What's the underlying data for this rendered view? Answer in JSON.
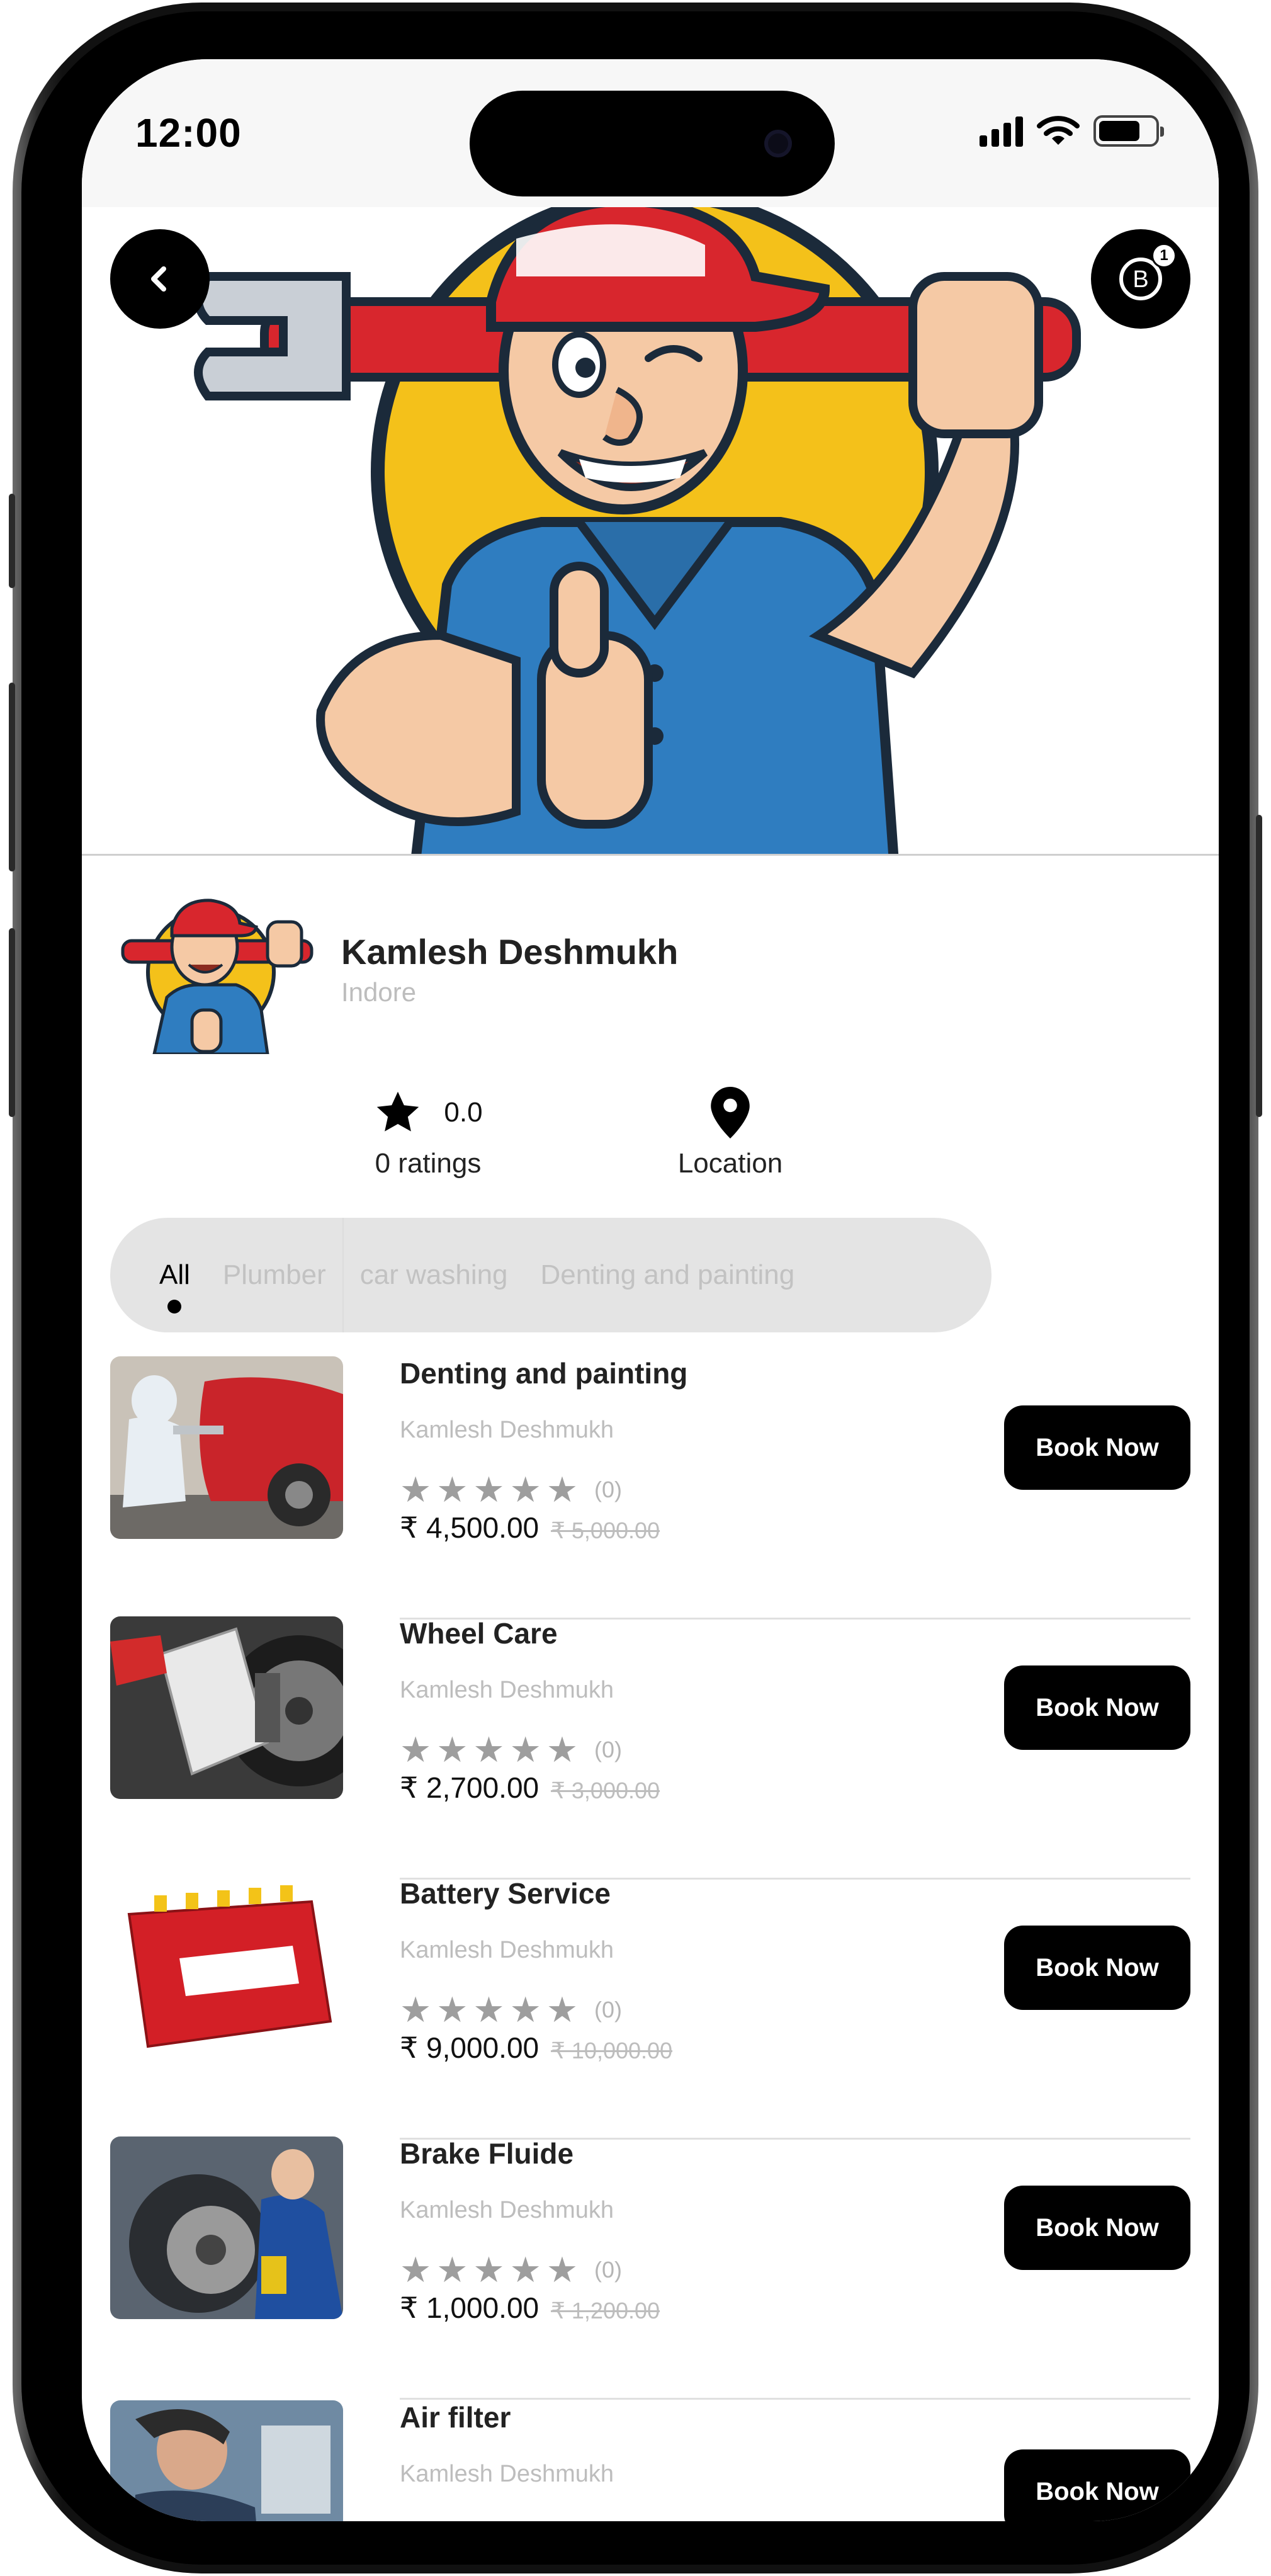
{
  "status_bar": {
    "time": "12:00"
  },
  "header": {
    "back_icon": "chevron-left-icon",
    "bookings_icon": "b-circle-icon",
    "bookings_badge": "1"
  },
  "provider": {
    "name": "Kamlesh Deshmukh",
    "city": "Indore",
    "rating_value": "0.0",
    "ratings_label": "0 ratings",
    "location_label": "Location"
  },
  "tabs": [
    {
      "label": "All",
      "active": true
    },
    {
      "label": "Plumber",
      "active": false
    },
    {
      "label": "car washing",
      "active": false
    },
    {
      "label": "Denting and painting",
      "active": false
    }
  ],
  "services": [
    {
      "title": "Denting and painting",
      "provider": "Kamlesh Deshmukh",
      "rating_count": "(0)",
      "price": "₹ 4,500.00",
      "old_price": "₹ 5,000.00",
      "cta": "Book Now",
      "image": "car-painting-image"
    },
    {
      "title": "Wheel Care",
      "provider": "Kamlesh Deshmukh",
      "rating_count": "(0)",
      "price": "₹ 2,700.00",
      "old_price": "₹ 3,000.00",
      "cta": "Book Now",
      "image": "wheel-alignment-image"
    },
    {
      "title": "Battery Service",
      "provider": "Kamlesh Deshmukh",
      "rating_count": "(0)",
      "price": "₹ 9,000.00",
      "old_price": "₹ 10,000.00",
      "cta": "Book Now",
      "image": "battery-image"
    },
    {
      "title": "Brake Fluide",
      "provider": "Kamlesh Deshmukh",
      "rating_count": "(0)",
      "price": "₹ 1,000.00",
      "old_price": "₹ 1,200.00",
      "cta": "Book Now",
      "image": "brake-service-image"
    },
    {
      "title": "Air filter",
      "provider": "Kamlesh Deshmukh",
      "rating_count": "",
      "price": "",
      "old_price": "",
      "cta": "Book Now",
      "image": "air-filter-image"
    }
  ],
  "colors": {
    "accent": "#000000",
    "muted_text": "#bdbdbd",
    "tab_bg": "#e4e4e4",
    "star_gray": "#9e9e9e"
  }
}
